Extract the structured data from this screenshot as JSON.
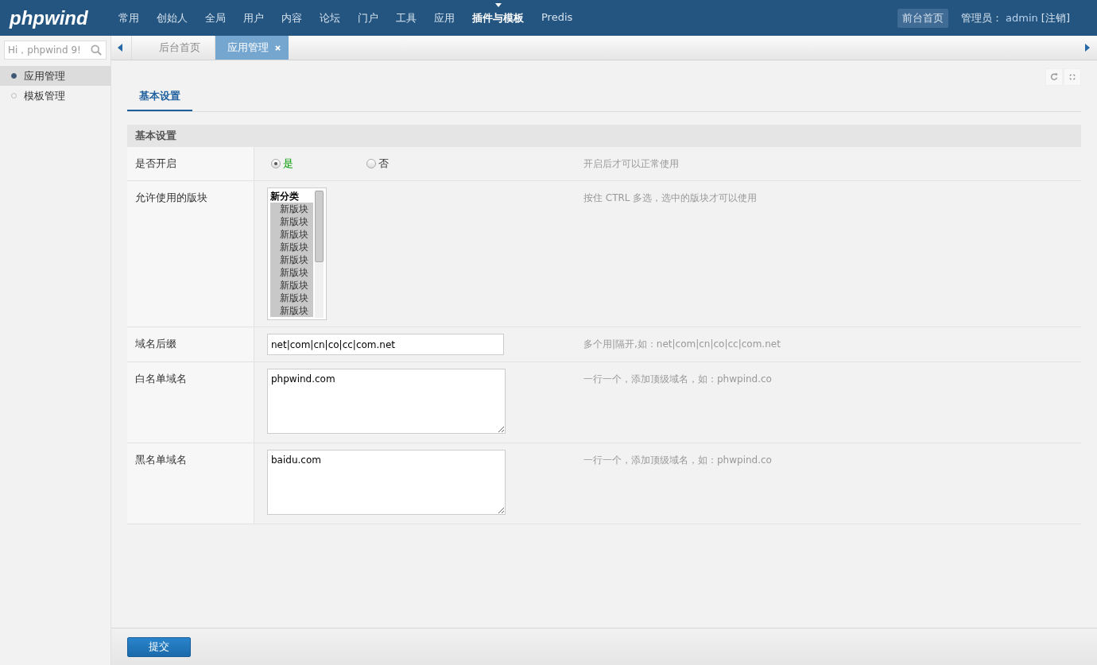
{
  "header": {
    "logo": "phpwind",
    "nav": [
      {
        "label": "常用",
        "selected": false
      },
      {
        "label": "创始人",
        "selected": false
      },
      {
        "label": "全局",
        "selected": false
      },
      {
        "label": "用户",
        "selected": false
      },
      {
        "label": "内容",
        "selected": false
      },
      {
        "label": "论坛",
        "selected": false
      },
      {
        "label": "门户",
        "selected": false
      },
      {
        "label": "工具",
        "selected": false
      },
      {
        "label": "应用",
        "selected": false
      },
      {
        "label": "插件与模板",
        "selected": true
      },
      {
        "label": "Predis",
        "selected": false
      }
    ],
    "front_link": "前台首页",
    "admin_label": "管理员：",
    "admin_name": "admin",
    "logout": "[注销]"
  },
  "sidebar": {
    "search": {
      "placeholder": "Hi，phpwind 9!"
    },
    "items": [
      {
        "label": "应用管理",
        "selected": true
      },
      {
        "label": "模板管理",
        "selected": false
      }
    ]
  },
  "tabs": [
    {
      "label": "后台首页",
      "selected": false,
      "closable": false
    },
    {
      "label": "应用管理",
      "selected": true,
      "closable": true
    }
  ],
  "subtabs": [
    {
      "label": "基本设置",
      "selected": true
    }
  ],
  "section": {
    "title": "基本设置"
  },
  "rows": [
    {
      "kind": "radio",
      "label": "是否开启",
      "options": [
        {
          "label": "是",
          "selected": true
        },
        {
          "label": "否",
          "selected": false
        }
      ],
      "hint": "开启后才可以正常使用"
    },
    {
      "kind": "multiselect",
      "label": "允许使用的版块",
      "group": "新分类",
      "options": [
        {
          "label": "新版块",
          "selected": true
        },
        {
          "label": "新版块",
          "selected": true
        },
        {
          "label": "新版块",
          "selected": true
        },
        {
          "label": "新版块",
          "selected": true
        },
        {
          "label": "新版块",
          "selected": true
        },
        {
          "label": "新版块",
          "selected": true
        },
        {
          "label": "新版块",
          "selected": true
        },
        {
          "label": "新版块",
          "selected": true
        },
        {
          "label": "新版块",
          "selected": true
        }
      ],
      "hint": "按住 CTRL 多选，选中的版块才可以使用"
    },
    {
      "kind": "input",
      "label": "域名后缀",
      "value": "net|com|cn|co|cc|com.net",
      "hint": "多个用|隔开,如：net|com|cn|co|cc|com.net"
    },
    {
      "kind": "textarea",
      "label": "白名单域名",
      "value": "phpwind.com",
      "hint": "一行一个，添加顶级域名，如：phwpind.co"
    },
    {
      "kind": "textarea",
      "label": "黑名单域名",
      "value": "baidu.com",
      "hint": "一行一个，添加顶级域名，如：phwpind.co"
    }
  ],
  "submit": "提交"
}
